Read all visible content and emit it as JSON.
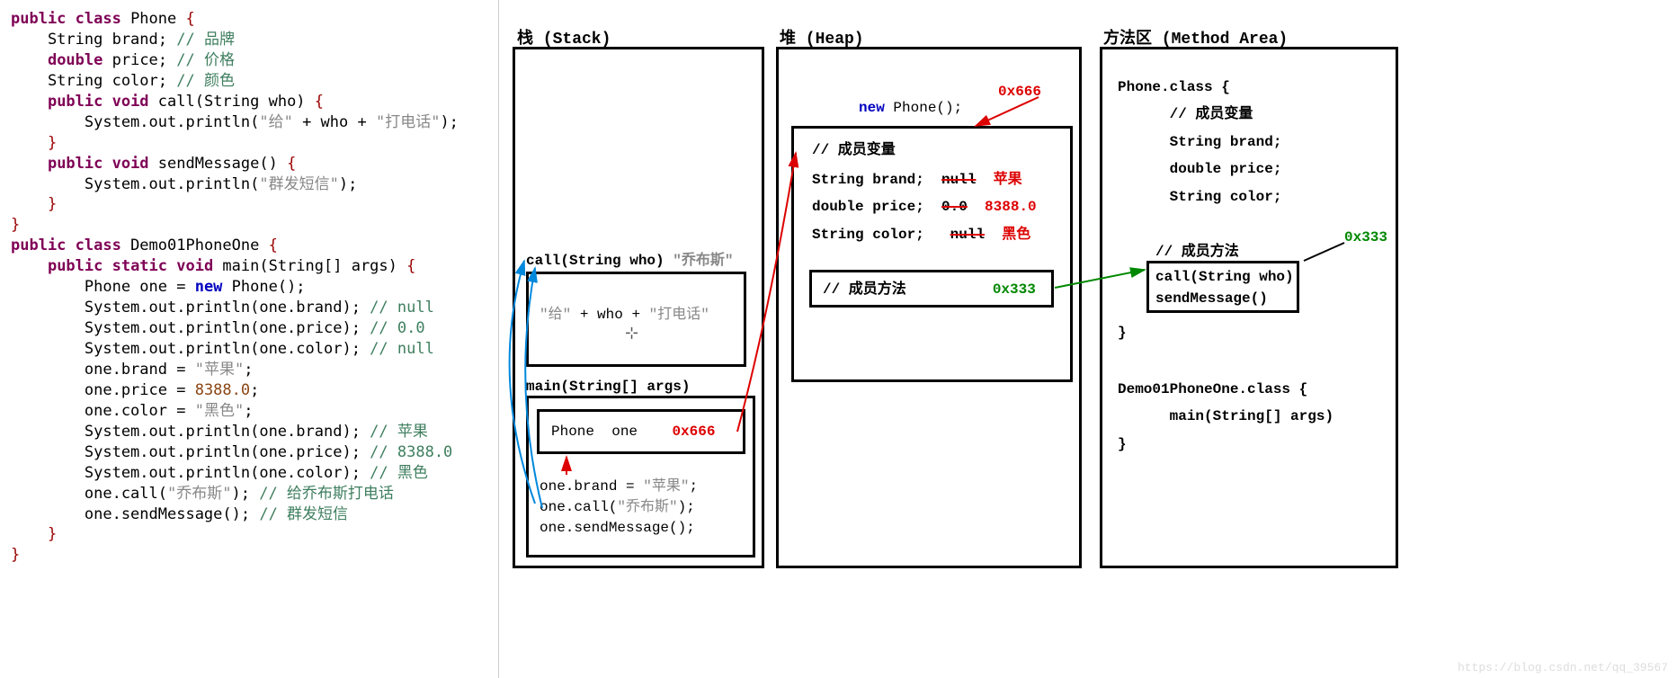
{
  "code": {
    "phone_class": {
      "decl": "public class Phone {",
      "brand": "    String brand; // 品牌",
      "price": "    double price; // 价格",
      "color": "    String color; // 颜色",
      "call_sig": "    public void call(String who) {",
      "call_body": "        System.out.println(\"给\" + who + \"打电话\");",
      "close1": "    }",
      "send_sig": "    public void sendMessage() {",
      "send_body": "        System.out.println(\"群发短信\");",
      "close2": "    }",
      "close3": "}"
    },
    "demo_class": {
      "decl": "public class Demo01PhoneOne {",
      "main_sig": "    public static void main(String[] args) {",
      "new_phone": "        Phone one = new Phone();",
      "p1": "        System.out.println(one.brand); // null",
      "p2": "        System.out.println(one.price); // 0.0",
      "p3": "        System.out.println(one.color); // null",
      "a1": "        one.brand = \"苹果\";",
      "a2": "        one.price = 8388.0;",
      "a3": "        one.color = \"黑色\";",
      "p4": "        System.out.println(one.brand); // 苹果",
      "p5": "        System.out.println(one.price); // 8388.0",
      "p6": "        System.out.println(one.color); // 黑色",
      "call": "        one.call(\"乔布斯\"); // 给乔布斯打电话",
      "send": "        one.sendMessage(); // 群发短信",
      "close1": "    }",
      "close2": "}"
    }
  },
  "stack": {
    "title": "栈  (Stack)",
    "call_label": "call(String who)",
    "call_arg": "\"乔布斯\"",
    "call_body_pre": "\"给\"",
    "call_body_plus1": " + ",
    "call_body_who": "who",
    "call_body_plus2": " + ",
    "call_body_post": "\"打电话\"",
    "main_label": "main(String[] args)",
    "main_var_type": "Phone",
    "main_var_name": "one",
    "main_var_addr": "0x666",
    "main_s1": "one.brand = \"苹果\";",
    "main_s2": "one.call(\"乔布斯\");",
    "main_s3": "one.sendMessage();"
  },
  "heap": {
    "title": "堆  (Heap)",
    "new_kw": "new",
    "new_rest": " Phone();",
    "addr": "0x666",
    "member_var_comment": "// 成员变量",
    "f1_decl": "String brand;",
    "f1_old": "null",
    "f1_new": "苹果",
    "f2_decl": "double price;",
    "f2_old": "0.0",
    "f2_new": "8388.0",
    "f3_decl": "String color;",
    "f3_old": "null",
    "f3_new": "黑色",
    "method_comment": "// 成员方法",
    "method_addr": "0x333"
  },
  "method_area": {
    "title": "方法区  (Method Area)",
    "phone_class": "Phone.class {",
    "mv_comment": "// 成员变量",
    "mv1": "String brand;",
    "mv2": "double price;",
    "mv3": "String color;",
    "mm_comment": "// 成员方法",
    "mm1": "call(String who)",
    "mm2": "sendMessage()",
    "close1": "}",
    "addr": "0x333",
    "demo_class": "Demo01PhoneOne.class {",
    "demo_main": "main(String[] args)",
    "close2": "}"
  },
  "watermark": "https://blog.csdn.net/qq_39567"
}
